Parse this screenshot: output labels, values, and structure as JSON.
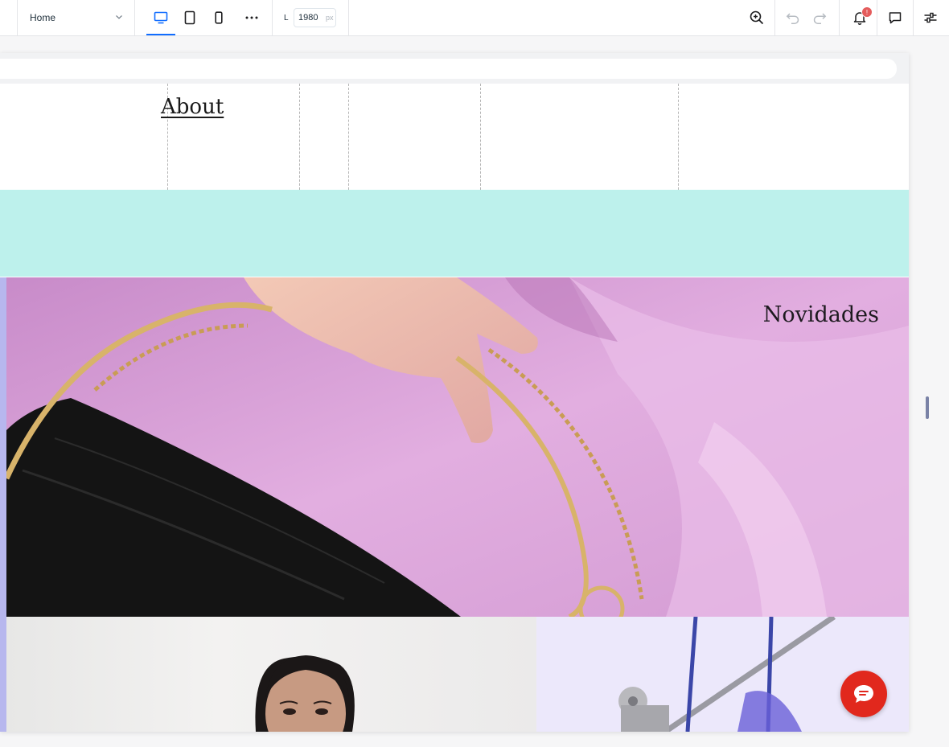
{
  "toolbar": {
    "page_select_value": "Home",
    "devices": [
      {
        "name": "desktop",
        "active": true
      },
      {
        "name": "tablet",
        "active": false
      },
      {
        "name": "mobile",
        "active": false
      }
    ],
    "more_icon": "more-horizontal-icon",
    "width_label": "L",
    "width_value": "1980",
    "width_unit": "px",
    "zoom_icon": "zoom-in-icon",
    "undo_icon": "undo-icon",
    "redo_icon": "redo-icon",
    "notifications_icon": "bell-icon",
    "notifications_badge": "!",
    "comments_icon": "comment-icon",
    "settings_icon": "sliders-icon",
    "accent_color": "#116dff"
  },
  "site": {
    "nav_link": "About",
    "hero_title": "Novidades",
    "teal_color": "#bdf1ec",
    "chat_color": "#e1281d"
  }
}
